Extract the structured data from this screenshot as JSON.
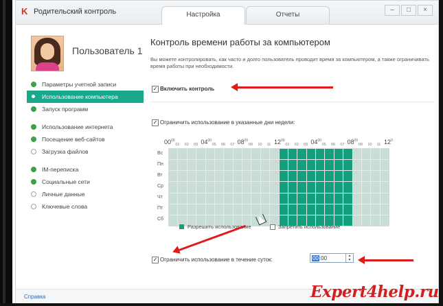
{
  "window": {
    "title": "Родительский контроль",
    "tabs": [
      {
        "label": "Настройка",
        "active": true
      },
      {
        "label": "Отчеты",
        "active": false
      }
    ],
    "controls": {
      "minimize": "–",
      "maximize": "□",
      "close": "×"
    }
  },
  "user": {
    "name": "Пользователь 1"
  },
  "sidebar": {
    "items": [
      {
        "label": "Параметры учетной записи",
        "state": "on"
      },
      {
        "label": "Использование компьютера",
        "state": "active"
      },
      {
        "label": "Запуск программ",
        "state": "on"
      },
      {
        "label": "Использование интернета",
        "state": "on"
      },
      {
        "label": "Посещение веб-сайтов",
        "state": "on"
      },
      {
        "label": "Загрузка файлов",
        "state": "off"
      },
      {
        "label": "IM-переписка",
        "state": "on"
      },
      {
        "label": "Социальные сети",
        "state": "on"
      },
      {
        "label": "Личные данные",
        "state": "off"
      },
      {
        "label": "Ключевые слова",
        "state": "off"
      }
    ]
  },
  "main": {
    "title": "Контроль времени работы за компьютером",
    "description": "Вы можете контролировать, как часто и долго пользователь проводит время за компьютером, а также ограничивать время работы при необходимости.",
    "enable_control": {
      "label": "Включить контроль",
      "checked": true
    },
    "limit_days": {
      "label": "Ограничить использование в указанные дни недели:",
      "checked": true
    },
    "schedule": {
      "hour_labels": [
        {
          "main": "00",
          "sup": "00"
        },
        {
          "main": "04",
          "sup": "00"
        },
        {
          "main": "08",
          "sup": "00"
        },
        {
          "main": "12",
          "sup": "00"
        },
        {
          "main": "04",
          "sup": "00"
        },
        {
          "main": "08",
          "sup": "00"
        },
        {
          "main": "12",
          "sup": "0"
        }
      ],
      "small_hours": [
        "01",
        "02",
        "03",
        "05",
        "06",
        "07",
        "09",
        "10",
        "11",
        "01",
        "02",
        "03",
        "05",
        "06",
        "07",
        "09",
        "10",
        "11"
      ],
      "days": [
        "Вс",
        "Пн",
        "Вт",
        "Ср",
        "Чт",
        "Пт",
        "Сб"
      ],
      "allowed_hours_start": 12,
      "allowed_hours_end": 20
    },
    "legend": {
      "allow": "Разрешить использование",
      "deny": "Запретить использование"
    },
    "limit_daily": {
      "label": "Ограничить использование в течение суток:",
      "checked": true,
      "value_hours": "00",
      "value_minutes": ":00"
    }
  },
  "footer": {
    "help": "Справка"
  },
  "watermark": "Expert4help.ru",
  "colors": {
    "accent": "#18a88a",
    "allowed": "#14a07e",
    "denied": "#c9dcd6",
    "arrow": "#e01919"
  }
}
